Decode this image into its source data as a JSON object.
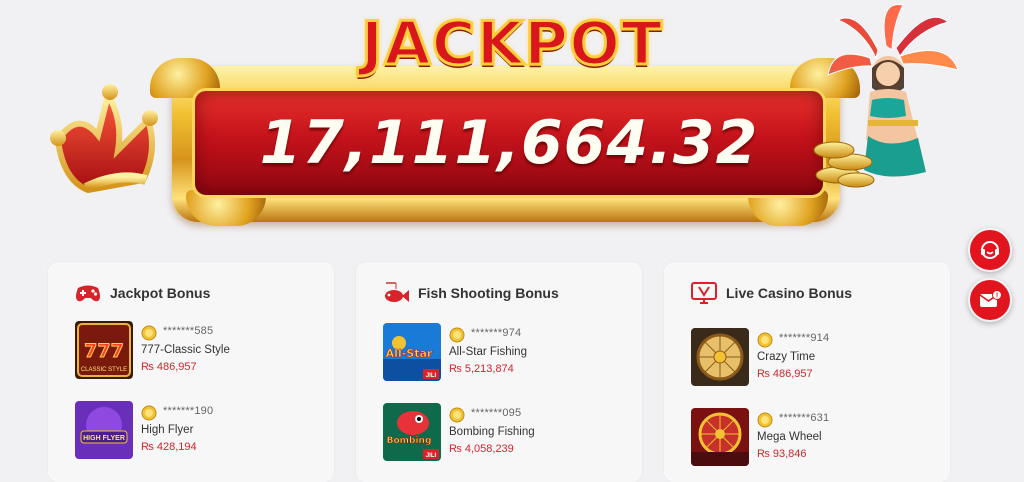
{
  "jackpot": {
    "title": "JACKPOT",
    "amount": "17,111,664.32"
  },
  "float_buttons": {
    "support_icon": "headset-icon",
    "mail_icon": "mail-icon"
  },
  "cards": [
    {
      "title": "Jackpot Bonus",
      "icon": "gamepad-icon",
      "items": [
        {
          "user": "*******585",
          "game": "777-Classic Style",
          "amount": "₨ 486,957",
          "thumb_text": "777",
          "thumb_sub": "CLASSIC STYLE"
        },
        {
          "user": "*******190",
          "game": "High Flyer",
          "amount": "₨ 428,194",
          "thumb_text": "HIGH FLYER",
          "thumb_sub": ""
        }
      ]
    },
    {
      "title": "Fish Shooting Bonus",
      "icon": "fish-icon",
      "items": [
        {
          "user": "*******974",
          "game": "All-Star Fishing",
          "amount": "₨ 5,213,874",
          "thumb_text": "All-Star",
          "thumb_sub": "JILI"
        },
        {
          "user": "*******095",
          "game": "Bombing Fishing",
          "amount": "₨ 4,058,239",
          "thumb_text": "Bombing",
          "thumb_sub": "JILI"
        }
      ]
    },
    {
      "title": "Live Casino Bonus",
      "icon": "live-casino-icon",
      "items": [
        {
          "user": "*******914",
          "game": "Crazy Time",
          "amount": "₨ 486,957",
          "thumb_text": "",
          "thumb_sub": ""
        },
        {
          "user": "*******631",
          "game": "Mega Wheel",
          "amount": "₨ 93,846",
          "thumb_text": "",
          "thumb_sub": ""
        }
      ]
    }
  ],
  "colors": {
    "accent_red": "#e2141d",
    "amount_red": "#d4252c",
    "gold": "#f2c233"
  }
}
